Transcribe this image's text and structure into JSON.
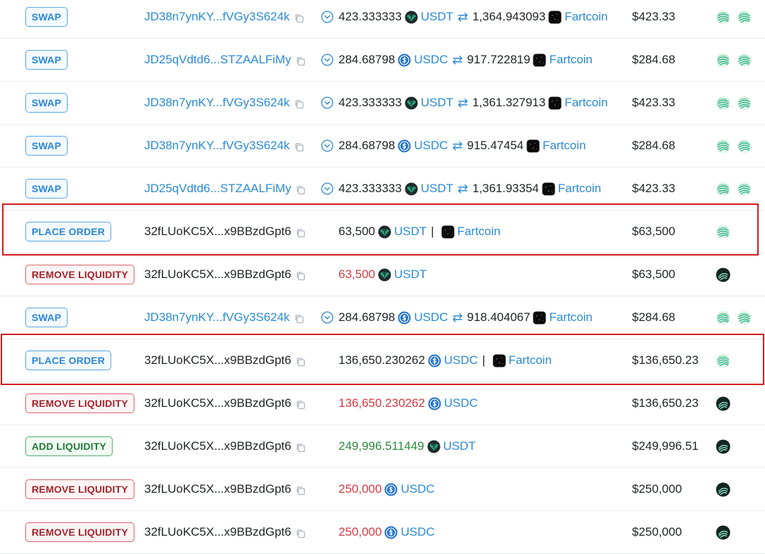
{
  "tokens": {
    "usdt_label": "USDT",
    "usdc_label": "USDC",
    "fartcoin_label": "Fartcoin"
  },
  "icons": {
    "copy": "copy-icon",
    "direction": "chevron-circle-down-icon",
    "swap_arrows": "⇄",
    "usdt": "usdt-token-icon",
    "usdc": "usdc-token-icon",
    "fartcoin": "fartcoin-token-icon",
    "platform_a": "lifinity-platform-icon",
    "platform_b": "dark-pool-platform-icon"
  },
  "colors": {
    "link": "#2b8ad8",
    "swap_badge": "#2b86d6",
    "remove_badge": "#a3222a",
    "add_badge": "#1e7a36",
    "negative": "#d9383e",
    "positive": "#2a8a3e",
    "highlight": "#d31b1b"
  },
  "rows": [
    {
      "type": "swap",
      "badge": "SWAP",
      "address": "JD38n7ynKY...fVGy3S624k",
      "amount_in": "423.333333",
      "token_in": "USDT",
      "amount_out": "1,364.943093",
      "token_out": "Fartcoin",
      "value": "$423.33",
      "platforms": [
        "lifinity",
        "lifinity"
      ]
    },
    {
      "type": "swap",
      "badge": "SWAP",
      "address": "JD25qVdtd6...STZAALFiMy",
      "amount_in": "284.68798",
      "token_in": "USDC",
      "amount_out": "917.722819",
      "token_out": "Fartcoin",
      "value": "$284.68",
      "platforms": [
        "lifinity",
        "lifinity"
      ]
    },
    {
      "type": "swap",
      "badge": "SWAP",
      "address": "JD38n7ynKY...fVGy3S624k",
      "amount_in": "423.333333",
      "token_in": "USDT",
      "amount_out": "1,361.327913",
      "token_out": "Fartcoin",
      "value": "$423.33",
      "platforms": [
        "lifinity",
        "lifinity"
      ]
    },
    {
      "type": "swap",
      "badge": "SWAP",
      "address": "JD38n7ynKY...fVGy3S624k",
      "amount_in": "284.68798",
      "token_in": "USDC",
      "amount_out": "915.47454",
      "token_out": "Fartcoin",
      "value": "$284.68",
      "platforms": [
        "lifinity",
        "lifinity"
      ]
    },
    {
      "type": "swap",
      "badge": "SWAP",
      "address": "JD25qVdtd6...STZAALFiMy",
      "amount_in": "423.333333",
      "token_in": "USDT",
      "amount_out": "1,361.93354",
      "token_out": "Fartcoin",
      "value": "$423.33",
      "platforms": [
        "lifinity",
        "lifinity"
      ]
    },
    {
      "type": "order",
      "badge": "PLACE ORDER",
      "address": "32fLUoKC5X...x9BBzdGpt6",
      "amount": "63,500",
      "token": "USDT",
      "pair_token": "Fartcoin",
      "value": "$63,500",
      "platforms": [
        "lifinity"
      ],
      "highlighted": true
    },
    {
      "type": "remove",
      "badge": "REMOVE LIQUIDITY",
      "address": "32fLUoKC5X...x9BBzdGpt6",
      "amount": "63,500",
      "token": "USDT",
      "value": "$63,500",
      "platforms": [
        "dark"
      ]
    },
    {
      "type": "swap",
      "badge": "SWAP",
      "address": "JD38n7ynKY...fVGy3S624k",
      "amount_in": "284.68798",
      "token_in": "USDC",
      "amount_out": "918.404067",
      "token_out": "Fartcoin",
      "value": "$284.68",
      "platforms": [
        "lifinity",
        "lifinity"
      ]
    },
    {
      "type": "order",
      "badge": "PLACE ORDER",
      "address": "32fLUoKC5X...x9BBzdGpt6",
      "amount": "136,650.230262",
      "token": "USDC",
      "pair_token": "Fartcoin",
      "value": "$136,650.23",
      "platforms": [
        "lifinity"
      ],
      "highlighted": true
    },
    {
      "type": "remove",
      "badge": "REMOVE LIQUIDITY",
      "address": "32fLUoKC5X...x9BBzdGpt6",
      "amount": "136,650.230262",
      "token": "USDC",
      "value": "$136,650.23",
      "platforms": [
        "dark"
      ]
    },
    {
      "type": "add",
      "badge": "ADD LIQUIDITY",
      "address": "32fLUoKC5X...x9BBzdGpt6",
      "amount": "249,996.511449",
      "token": "USDT",
      "value": "$249,996.51",
      "platforms": [
        "dark"
      ]
    },
    {
      "type": "remove",
      "badge": "REMOVE LIQUIDITY",
      "address": "32fLUoKC5X...x9BBzdGpt6",
      "amount": "250,000",
      "token": "USDC",
      "value": "$250,000",
      "platforms": [
        "dark"
      ]
    },
    {
      "type": "remove",
      "badge": "REMOVE LIQUIDITY",
      "address": "32fLUoKC5X...x9BBzdGpt6",
      "amount": "250,000",
      "token": "USDC",
      "value": "$250,000",
      "platforms": [
        "dark"
      ]
    }
  ]
}
